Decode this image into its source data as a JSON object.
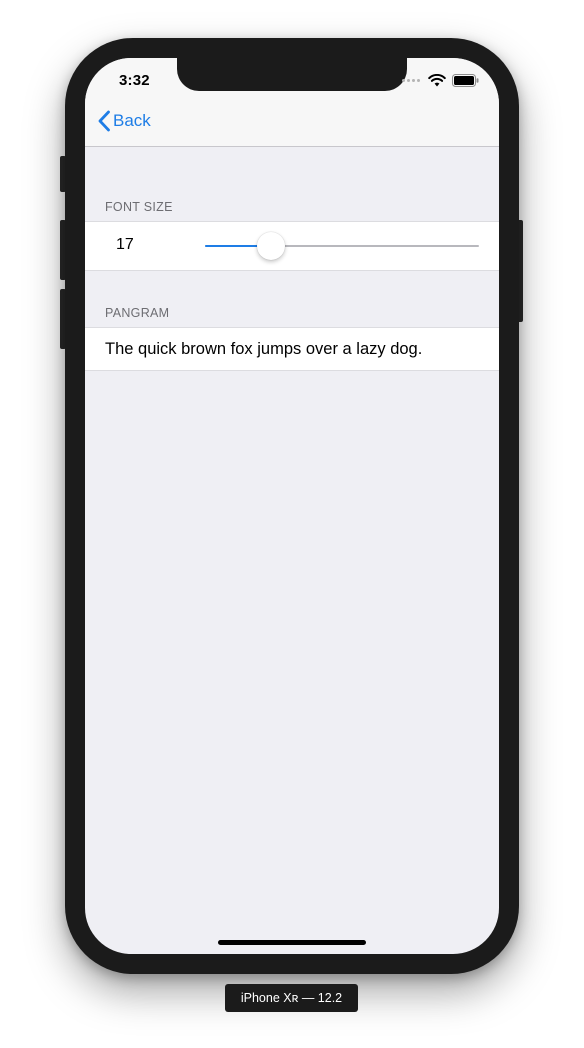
{
  "status_bar": {
    "time": "3:32",
    "icons": [
      "cellular-signal-icon",
      "wifi-icon",
      "battery-icon"
    ]
  },
  "nav": {
    "back_label": "Back",
    "back_icon": "chevron-left-icon"
  },
  "sections": {
    "font_size": {
      "header": "FONT SIZE",
      "value": "17",
      "slider_fraction": 0.24
    },
    "pangram": {
      "header": "PANGRAM",
      "text": "The quick brown fox jumps over a lazy dog."
    }
  },
  "device": {
    "label": "iPhone Xʀ — 12.2"
  },
  "colors": {
    "accent": "#1e7de6",
    "background": "#efeff4",
    "navbar": "#f7f7f7",
    "section_header_text": "#6d6d72",
    "device_frame": "#1b1b1b"
  }
}
